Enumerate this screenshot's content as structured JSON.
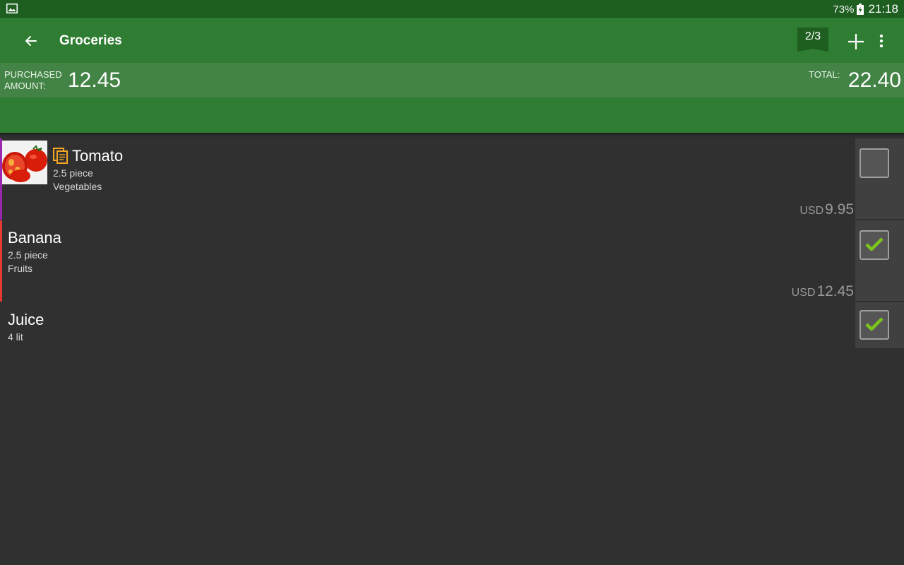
{
  "status_bar": {
    "battery": "73%",
    "time": "21:18"
  },
  "header": {
    "title": "Groceries",
    "page_indicator": "2/3",
    "purchased_label_line1": "PURCHASED",
    "purchased_label_line2": "AMOUNT:",
    "purchased_value": "12.45",
    "total_label": "TOTAL:",
    "total_value": "22.40"
  },
  "items": [
    {
      "name": "Tomato",
      "quantity": "2.5 piece",
      "category": "Vegetables",
      "currency": "USD",
      "price": "9.95",
      "checked": false,
      "color": "#9c27b0"
    },
    {
      "name": "Banana",
      "quantity": "2.5 piece",
      "category": "Fruits",
      "currency": "USD",
      "price": "12.45",
      "checked": true,
      "color": "#e53935"
    },
    {
      "name": "Juice",
      "quantity": "4 lit",
      "checked": true
    }
  ],
  "colors": {
    "appbar": "#2e7d32",
    "statusbar": "#1e5e20",
    "summary": "#438446",
    "check": "#7cc31e",
    "note_icon": "#f5a623"
  }
}
